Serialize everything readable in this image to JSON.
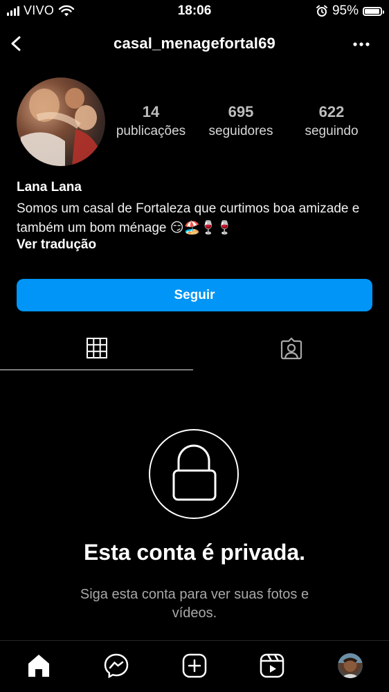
{
  "status_bar": {
    "carrier": "VIVO",
    "time": "18:06",
    "battery": "95%",
    "battery_level": 0.95,
    "icons": [
      "signal-icon",
      "wifi-icon",
      "alarm-icon",
      "battery-icon"
    ]
  },
  "header": {
    "username": "casal_menagefortal69",
    "back_icon": "chevron-left-icon",
    "more_icon": "more-horizontal-icon"
  },
  "profile": {
    "stats": [
      {
        "value": "14",
        "label": "publicações"
      },
      {
        "value": "695",
        "label": "seguidores"
      },
      {
        "value": "622",
        "label": "seguindo"
      }
    ],
    "display_name": "Lana Lana",
    "bio": "Somos um casal de Fortaleza que curtimos boa amizade e também um bom ménage 😏🏖️🍷🍷",
    "translate_label": "Ver tradução"
  },
  "follow_button": {
    "label": "Seguir",
    "color": "#0095f6"
  },
  "tabs": {
    "items": [
      "grid-icon",
      "tagged-icon"
    ],
    "active": "grid-icon"
  },
  "private": {
    "title": "Esta conta é privada.",
    "subtitle": "Siga esta conta para ver suas fotos e vídeos."
  },
  "bottom_nav": {
    "items": [
      "home-icon",
      "messenger-icon",
      "create-icon",
      "reels-icon",
      "profile-avatar"
    ]
  }
}
